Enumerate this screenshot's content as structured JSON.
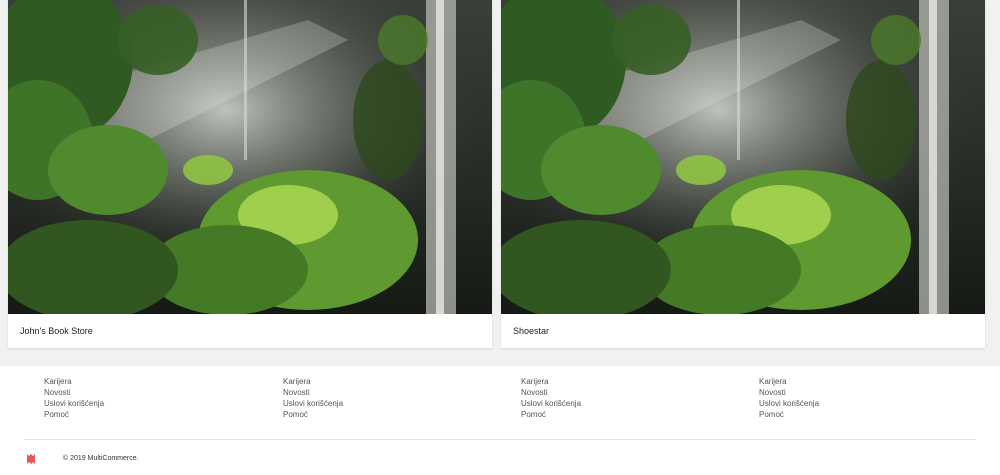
{
  "stores": [
    {
      "name": "John's Book Store",
      "image": "forest-photo"
    },
    {
      "name": "Shoestar",
      "image": "forest-photo"
    }
  ],
  "footer": {
    "columns": [
      {
        "links": [
          "Karijera",
          "Novosti",
          "Uslovi korišćenja",
          "Pomoć"
        ]
      },
      {
        "links": [
          "Karijera",
          "Novosti",
          "Uslovi korišćenja",
          "Pomoć"
        ]
      },
      {
        "links": [
          "Karijera",
          "Novosti",
          "Uslovi korišćenja",
          "Pomoć"
        ]
      },
      {
        "links": [
          "Karijera",
          "Novosti",
          "Uslovi korišćenja",
          "Pomoć"
        ]
      }
    ],
    "copyright": "© 2019 MultiCommerce.",
    "brand_icon": "multicommerce-logo-icon",
    "brand_color": "#e8555a"
  }
}
